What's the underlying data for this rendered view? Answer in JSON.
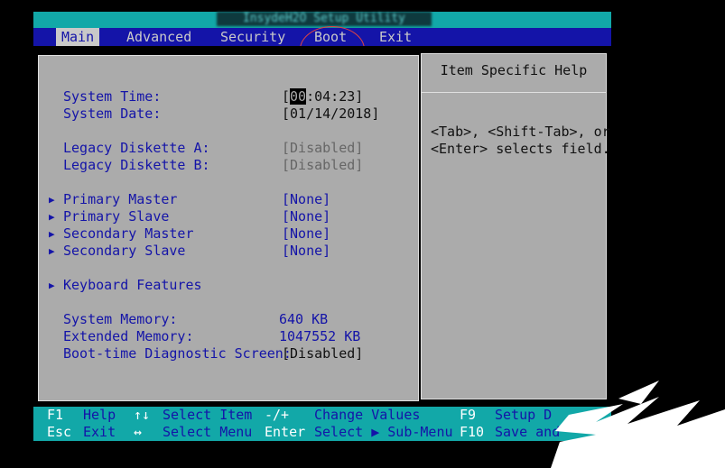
{
  "title": "InsydeH2O Setup Utility",
  "menu": [
    "Main",
    "Advanced",
    "Security",
    "Boot",
    "Exit"
  ],
  "help": {
    "title": "Item Specific Help",
    "lines": [
      "<Tab>, <Shift-Tab>, or",
      "<Enter> selects field."
    ]
  },
  "settings": {
    "system_time_label": "System Time:",
    "system_time_cursor": "00",
    "system_time_rest": ":04:23]",
    "system_date_label": "System Date:",
    "system_date_value": "[01/14/2018]",
    "legacy_a_label": "Legacy Diskette A:",
    "legacy_a_value": "[Disabled]",
    "legacy_b_label": "Legacy Diskette B:",
    "legacy_b_value": "[Disabled]",
    "primary_master_label": "Primary Master",
    "primary_master_value": "[None]",
    "primary_slave_label": "Primary Slave",
    "primary_slave_value": "[None]",
    "secondary_master_label": "Secondary Master",
    "secondary_master_value": "[None]",
    "secondary_slave_label": "Secondary Slave",
    "secondary_slave_value": "[None]",
    "keyboard_label": "Keyboard Features",
    "system_memory_label": "System Memory:",
    "system_memory_value": "640 KB",
    "extended_memory_label": "Extended Memory:",
    "extended_memory_value": "1047552 KB",
    "boot_diag_label": "Boot-time Diagnostic Screen:",
    "boot_diag_value": "[Disabled]"
  },
  "footer": {
    "f1": "F1",
    "help": "Help",
    "esc": "Esc",
    "exit": "Exit",
    "updown": "↑↓",
    "select_item": "Select Item",
    "leftright": "↔",
    "select_menu": "Select Menu",
    "minusplus": "-/+",
    "change_values": "Change Values",
    "enter": "Enter",
    "select_submenu": "Select ▶ Sub-Menu",
    "f9": "F9",
    "setup_defaults": "Setup D",
    "f10": "F10",
    "save_exit": "Save and"
  },
  "colors": {
    "menu_blue": "#1414a8",
    "teal": "#12a8a8",
    "panel_gray": "#ababab"
  }
}
